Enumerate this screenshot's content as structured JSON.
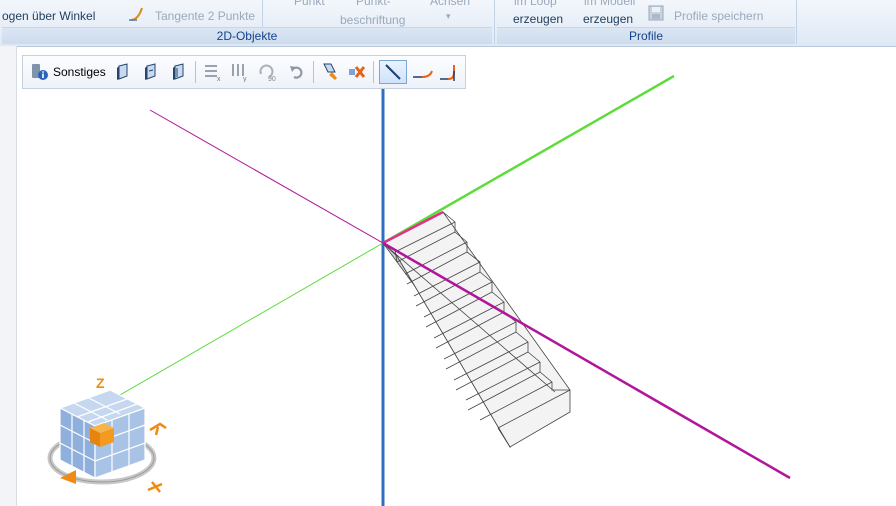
{
  "ribbon": {
    "item_winkel": "ogen über Winkel",
    "item_tangente": "Tangente 2 Punkte",
    "item_punkt": "Punkt",
    "item_punkt_beschr_1": "Punkt-",
    "item_punkt_beschr_2": "beschriftung",
    "item_achsen": "Achsen",
    "item_in_loop": "im Loop",
    "item_erzeugen_1": "erzeugen",
    "item_im_modell": "im Modell",
    "item_erzeugen_2": "erzeugen",
    "item_profile_speichern": "Profile speichern",
    "group_2d": "2D-Objekte",
    "group_profile": "Profile"
  },
  "toolbar": {
    "sonstiges_label": "Sonstiges"
  },
  "colors": {
    "axis_vertical": "#2e6fc4",
    "axis_green": "#5fdc3c",
    "axis_magenta": "#b1169a",
    "stair_highlight": "#e0308a",
    "cube_blue": "#a9c3e6",
    "cube_orange": "#f39a1f"
  },
  "icons": {
    "sonstiges": "info-tools-icon",
    "shape_1": "extrude-shape-icon",
    "shape_2": "extrude-shape-alt-icon",
    "shape_3": "extrude-shape-third-icon",
    "mirror_x": "mirror-x-icon",
    "mirror_y": "mirror-y-icon",
    "rotate_90": "rotate-90-icon",
    "undo": "undo-icon",
    "edit_point": "edit-point-icon",
    "delete": "delete-icon",
    "line": "line-tool-icon",
    "tangent": "tangent-curve-icon",
    "angle": "angle-curve-icon"
  }
}
